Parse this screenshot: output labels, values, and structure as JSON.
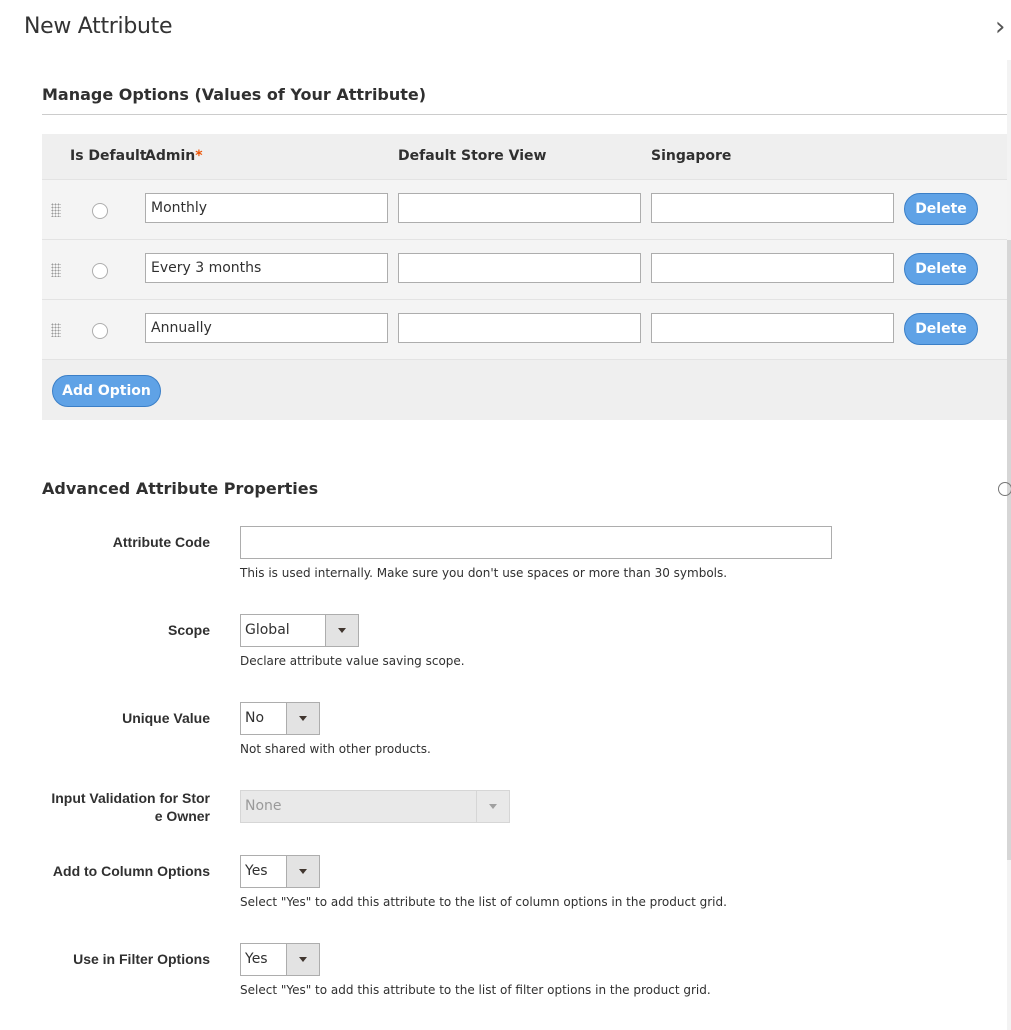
{
  "header": {
    "title": "New Attribute",
    "close_glyph": "›"
  },
  "manage_options": {
    "title": "Manage Options (Values of Your Attribute)",
    "columns": {
      "is_default": "Is Default",
      "admin": "Admin",
      "required_mark": "*",
      "default_store_view": "Default Store View",
      "singapore": "Singapore"
    },
    "rows": [
      {
        "admin": "Monthly",
        "default_store_view": "",
        "singapore": "",
        "is_default": false
      },
      {
        "admin": "Every 3 months",
        "default_store_view": "",
        "singapore": "",
        "is_default": false
      },
      {
        "admin": "Annually",
        "default_store_view": "",
        "singapore": "",
        "is_default": false
      }
    ],
    "delete_label": "Delete",
    "add_option_label": "Add Option"
  },
  "advanced": {
    "title": "Advanced Attribute Properties",
    "attribute_code": {
      "label": "Attribute Code",
      "value": "",
      "note": "This is used internally. Make sure you don't use spaces or more than 30 symbols."
    },
    "scope": {
      "label": "Scope",
      "value": "Global",
      "note": "Declare attribute value saving scope."
    },
    "unique_value": {
      "label": "Unique Value",
      "value": "No",
      "note": "Not shared with other products."
    },
    "input_validation": {
      "label_line1": "Input Validation for Stor",
      "label_line2": "e Owner",
      "value": "None",
      "disabled": true
    },
    "add_to_column": {
      "label": "Add to Column Options",
      "value": "Yes",
      "note": "Select \"Yes\" to add this attribute to the list of column options in the product grid."
    },
    "use_in_filter": {
      "label": "Use in Filter Options",
      "value": "Yes",
      "note": "Select \"Yes\" to add this attribute to the list of filter options in the product grid."
    }
  },
  "colors": {
    "button_blue": "#5fa2e6",
    "required_orange": "#eb5202",
    "panel_gray": "#efefef"
  }
}
